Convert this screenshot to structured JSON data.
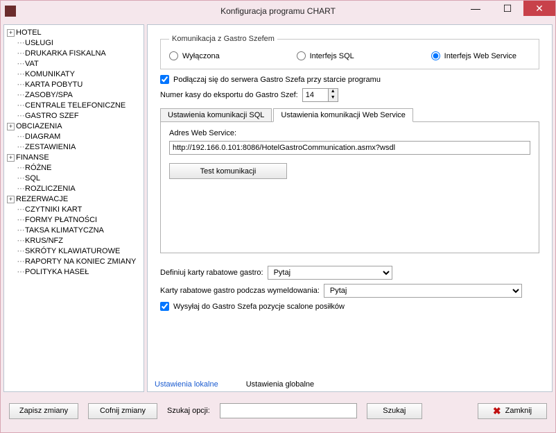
{
  "window": {
    "title": "Konfiguracja programu CHART"
  },
  "tree": [
    {
      "exp": "+",
      "label": "HOTEL"
    },
    {
      "child": true,
      "label": "USŁUGI"
    },
    {
      "child": true,
      "label": "DRUKARKA FISKALNA"
    },
    {
      "child": true,
      "label": "VAT"
    },
    {
      "child": true,
      "label": "KOMUNIKATY"
    },
    {
      "child": true,
      "label": "KARTA POBYTU"
    },
    {
      "child": true,
      "label": "ZASOBY/SPA"
    },
    {
      "child": true,
      "label": "CENTRALE TELEFONICZNE"
    },
    {
      "child": true,
      "label": "GASTRO SZEF"
    },
    {
      "exp": "+",
      "label": "OBCIAZENIA"
    },
    {
      "child": true,
      "label": "DIAGRAM"
    },
    {
      "child": true,
      "label": "ZESTAWIENIA"
    },
    {
      "exp": "+",
      "label": "FINANSE"
    },
    {
      "child": true,
      "label": "RÓŻNE"
    },
    {
      "child": true,
      "label": "SQL"
    },
    {
      "child": true,
      "label": "ROZLICZENIA"
    },
    {
      "exp": "+",
      "label": "REZERWACJE"
    },
    {
      "child": true,
      "label": "CZYTNIKI KART"
    },
    {
      "child": true,
      "label": "FORMY PŁATNOŚCI"
    },
    {
      "child": true,
      "label": "TAKSA KLIMATYCZNA"
    },
    {
      "child": true,
      "label": "KRUS/NFZ"
    },
    {
      "child": true,
      "label": "SKRÓTY KLAWIATUROWE"
    },
    {
      "child": true,
      "label": "RAPORTY NA KONIEC ZMIANY"
    },
    {
      "child": true,
      "label": "POLITYKA HASEŁ"
    }
  ],
  "main": {
    "group_legend": "Komunikacja z Gastro Szefem",
    "radio": {
      "off": "Wyłączona",
      "sql": "Interfejs SQL",
      "web": "Interfejs Web Service",
      "selected": "web"
    },
    "connect_checkbox": {
      "label": "Podłączaj się do serwera Gastro Szefa przy starcie programu",
      "checked": true
    },
    "cash_number": {
      "label": "Numer kasy do eksportu do Gastro Szef:",
      "value": "14"
    },
    "tabs": {
      "sql": "Ustawienia komunikacji SQL",
      "web": "Ustawienia komunikacji Web Service"
    },
    "webservice": {
      "label": "Adres Web Service:",
      "url": "http://192.166.0.101:8086/HotelGastroCommunication.asmx?wsdl",
      "test_button": "Test komunikacji"
    },
    "define_cards": {
      "label": "Definiuj karty rabatowe gastro:",
      "value": "Pytaj"
    },
    "checkout_cards": {
      "label": "Karty rabatowe gastro podczas wymeldowania:",
      "value": "Pytaj"
    },
    "send_merged": {
      "label": "Wysyłaj do Gastro Szefa pozycje scalone posiłków",
      "checked": true
    },
    "footer": {
      "local": "Ustawienia lokalne",
      "global": "Ustawienia globalne"
    }
  },
  "bottom": {
    "save": "Zapisz zmiany",
    "undo": "Cofnij zmiany",
    "search_label": "Szukaj opcji:",
    "search": "Szukaj",
    "close": "Zamknij"
  }
}
